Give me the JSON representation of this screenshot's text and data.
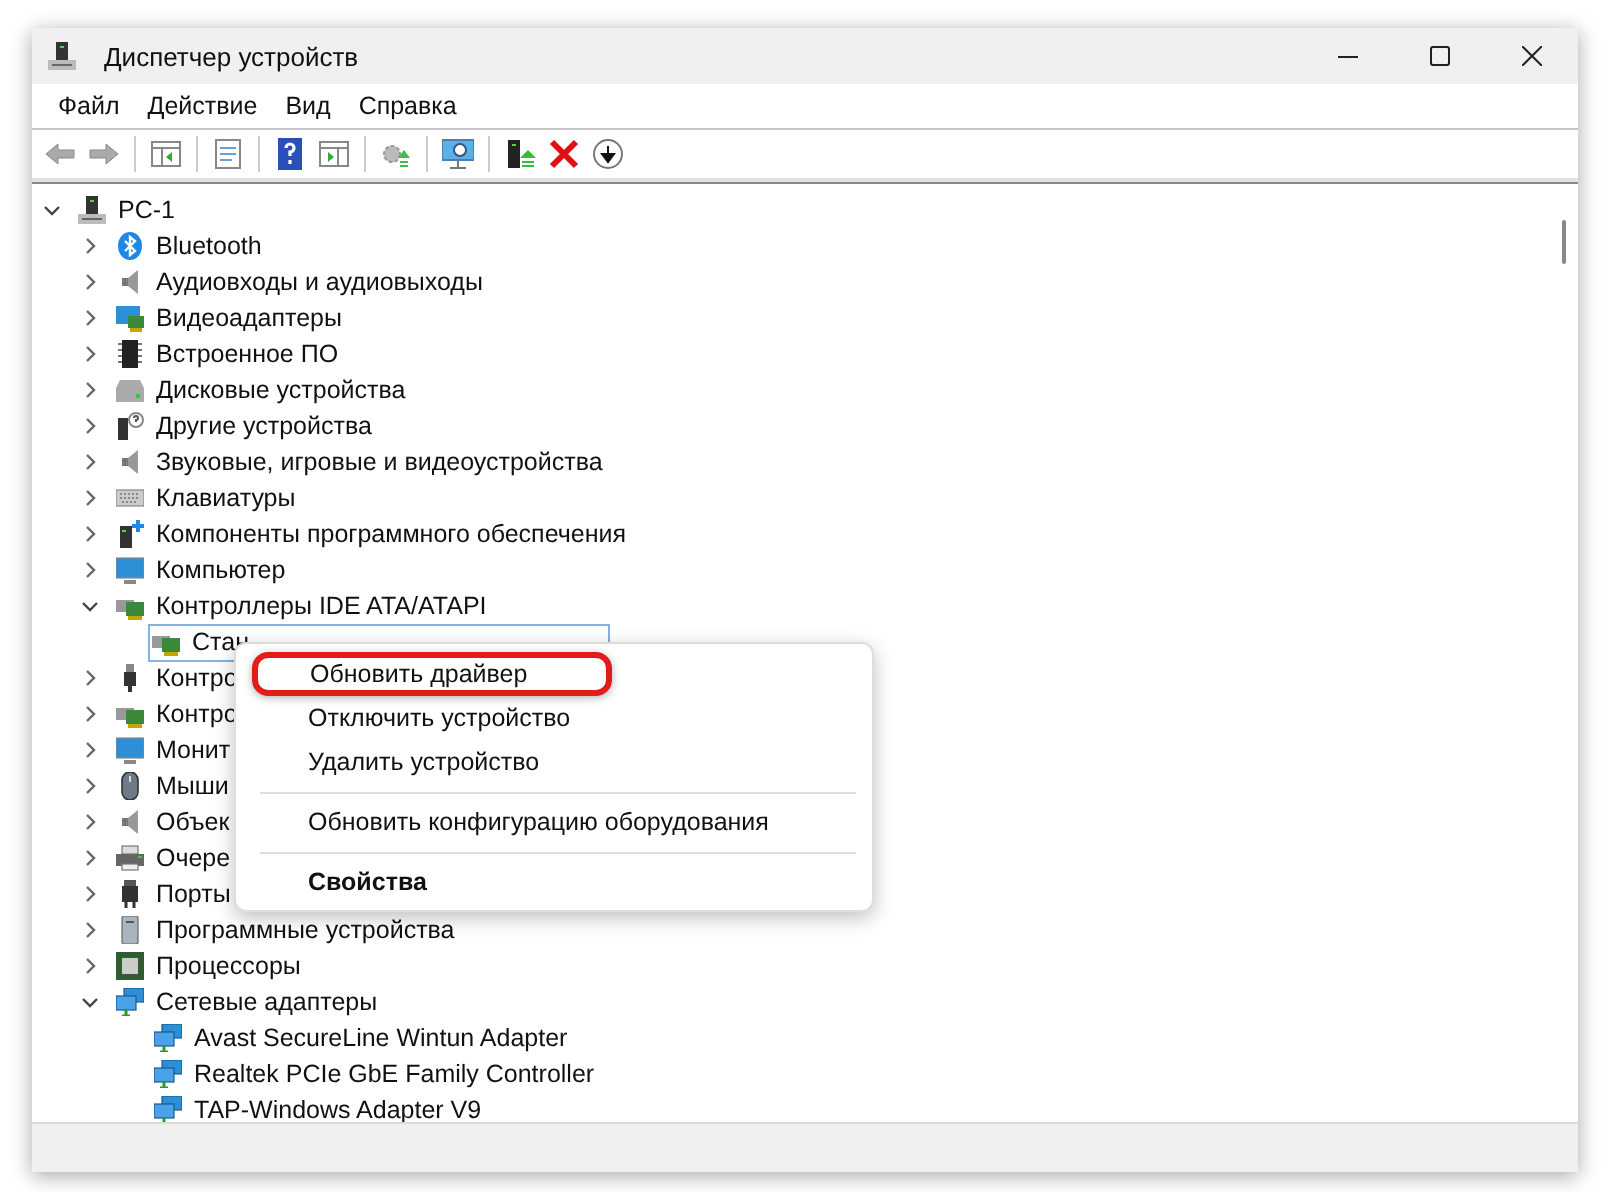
{
  "window": {
    "title": "Диспетчер устройств"
  },
  "menu_bar": [
    {
      "label": "Файл"
    },
    {
      "label": "Действие"
    },
    {
      "label": "Вид"
    },
    {
      "label": "Справка"
    }
  ],
  "toolbar": [
    {
      "kind": "back",
      "disabled": true
    },
    {
      "kind": "forward",
      "disabled": true
    },
    {
      "kind": "separator"
    },
    {
      "kind": "pane"
    },
    {
      "kind": "separator"
    },
    {
      "kind": "sheet"
    },
    {
      "kind": "separator"
    },
    {
      "kind": "help"
    },
    {
      "kind": "run"
    },
    {
      "kind": "separator"
    },
    {
      "kind": "update",
      "disabled": true
    },
    {
      "kind": "separator"
    },
    {
      "kind": "scan"
    },
    {
      "kind": "separator"
    },
    {
      "kind": "enable"
    },
    {
      "kind": "remove"
    },
    {
      "kind": "download"
    }
  ],
  "tree": {
    "label": "PC-1",
    "expanded": true,
    "children": [
      {
        "label": "Bluetooth",
        "expanded": false
      },
      {
        "label": "Аудиовходы и аудиовыходы",
        "expanded": false
      },
      {
        "label": "Видеоадаптеры",
        "expanded": false
      },
      {
        "label": "Встроенное ПО",
        "expanded": false
      },
      {
        "label": "Дисковые устройства",
        "expanded": false
      },
      {
        "label": "Другие устройства",
        "expanded": false
      },
      {
        "label": "Звуковые, игровые и видеоустройства",
        "expanded": false
      },
      {
        "label": "Клавиатуры",
        "expanded": false
      },
      {
        "label": "Компоненты программного обеспечения",
        "expanded": false
      },
      {
        "label": "Компьютер",
        "expanded": false
      },
      {
        "label": "Контроллеры IDE ATA/ATAPI",
        "expanded": true,
        "children": [
          {
            "label": "Стан",
            "selected": true
          }
        ]
      },
      {
        "label": "Контро",
        "expanded": false
      },
      {
        "label": "Контро",
        "expanded": false
      },
      {
        "label": "Монит",
        "expanded": false
      },
      {
        "label": "Мыши",
        "expanded": false
      },
      {
        "label": "Объек",
        "expanded": false
      },
      {
        "label": "Очере",
        "expanded": false
      },
      {
        "label": "Порты",
        "expanded": false
      },
      {
        "label": "Программные устройства",
        "expanded": false
      },
      {
        "label": "Процессоры",
        "expanded": false
      },
      {
        "label": "Сетевые адаптеры",
        "expanded": true,
        "children": [
          {
            "label": "Avast SecureLine Wintun Adapter",
            "selected": false
          },
          {
            "label": "Realtek PCIe GbE Family Controller",
            "selected": false
          },
          {
            "label": "TAP-Windows Adapter V9",
            "selected": false
          }
        ]
      }
    ]
  },
  "context_menu": [
    {
      "kind": "item",
      "label": "Обновить драйвер",
      "highlighted": true,
      "default": false
    },
    {
      "kind": "item",
      "label": "Отключить устройство",
      "highlighted": false,
      "default": false
    },
    {
      "kind": "item",
      "label": "Удалить устройство",
      "highlighted": false,
      "default": false
    },
    {
      "kind": "separator"
    },
    {
      "kind": "item",
      "label": "Обновить конфигурацию оборудования",
      "highlighted": false,
      "default": false
    },
    {
      "kind": "separator"
    },
    {
      "kind": "item",
      "label": "Свойства",
      "highlighted": false,
      "default": true
    }
  ]
}
